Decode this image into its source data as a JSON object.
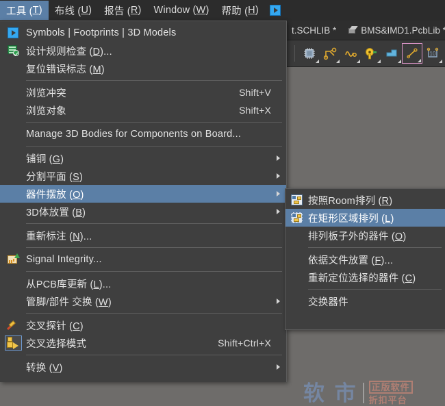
{
  "menubar": {
    "items": [
      {
        "label": "工具 (T)",
        "text": "工具 (",
        "mnemonic": "T",
        "tail": ")",
        "active": true,
        "name": "menubar-item-tools"
      },
      {
        "label": "布线 (U)",
        "text": "布线 (",
        "mnemonic": "U",
        "tail": ")",
        "active": false,
        "name": "menubar-item-route"
      },
      {
        "label": "报告 (R)",
        "text": "报告 (",
        "mnemonic": "R",
        "tail": ")",
        "active": false,
        "name": "menubar-item-reports"
      },
      {
        "label": "Window (W)",
        "text": "Window (",
        "mnemonic": "W",
        "tail": ")",
        "active": false,
        "name": "menubar-item-window"
      },
      {
        "label": "帮助 (H)",
        "text": "帮助 (",
        "mnemonic": "H",
        "tail": ")",
        "active": false,
        "name": "menubar-item-help"
      }
    ],
    "overflow_icon": "play-box-icon"
  },
  "tabs": [
    {
      "label": "t.SCHLIB *",
      "icon": null
    },
    {
      "label": "BMS&IMD1.PcbLib *",
      "icon": "cube-icon"
    }
  ],
  "toolbar": {
    "buttons": [
      {
        "name": "place-component-icon",
        "label": "",
        "framed": false
      },
      {
        "name": "place-interactive-route-icon",
        "label": "",
        "framed": false
      },
      {
        "name": "place-differential-pair-icon",
        "label": "",
        "framed": false
      },
      {
        "name": "place-pad-icon",
        "label": "",
        "framed": false
      },
      {
        "name": "place-polygon-icon",
        "label": "",
        "framed": false
      },
      {
        "name": "place-line-icon",
        "label": "",
        "framed": true
      },
      {
        "name": "place-dimension-icon",
        "label": "10",
        "framed": false
      }
    ]
  },
  "tools_menu": {
    "title": "工具",
    "items": [
      {
        "type": "item",
        "icon": "play-box-icon",
        "label": "Symbols | Footprints | 3D Models",
        "mnemonic": "",
        "shortcut": "",
        "submenu": false,
        "highlight": false,
        "name": "menu-item-symbols-footprints-3d-models"
      },
      {
        "type": "item",
        "icon": "drc-icon",
        "label": "设计规则检查 (",
        "mnemonic": "D",
        "tail": ")...",
        "shortcut": "",
        "submenu": false,
        "highlight": false,
        "name": "menu-item-design-rule-check"
      },
      {
        "type": "item",
        "icon": "",
        "label": "复位错误标志 (",
        "mnemonic": "M",
        "tail": ")",
        "shortcut": "",
        "submenu": false,
        "highlight": false,
        "name": "menu-item-reset-error-markers"
      },
      {
        "type": "sep"
      },
      {
        "type": "item",
        "icon": "",
        "label": "浏览冲突",
        "mnemonic": "",
        "tail": "",
        "shortcut": "Shift+V",
        "submenu": false,
        "highlight": false,
        "name": "menu-item-browse-violations"
      },
      {
        "type": "item",
        "icon": "",
        "label": "浏览对象",
        "mnemonic": "",
        "tail": "",
        "shortcut": "Shift+X",
        "submenu": false,
        "highlight": false,
        "name": "menu-item-browse-objects"
      },
      {
        "type": "sep"
      },
      {
        "type": "item",
        "icon": "",
        "label": "Manage 3D Bodies for Components on Board...",
        "mnemonic": "",
        "tail": "",
        "shortcut": "",
        "submenu": false,
        "highlight": false,
        "name": "menu-item-manage-3d-bodies"
      },
      {
        "type": "sep"
      },
      {
        "type": "item",
        "icon": "",
        "label": "铺铜 (",
        "mnemonic": "G",
        "tail": ")",
        "shortcut": "",
        "submenu": true,
        "highlight": false,
        "name": "menu-item-polygon-pours"
      },
      {
        "type": "item",
        "icon": "",
        "label": "分割平面 (",
        "mnemonic": "S",
        "tail": ")",
        "shortcut": "",
        "submenu": true,
        "highlight": false,
        "name": "menu-item-split-planes"
      },
      {
        "type": "item",
        "icon": "",
        "label": "器件摆放 (",
        "mnemonic": "O",
        "tail": ")",
        "shortcut": "",
        "submenu": true,
        "highlight": true,
        "name": "menu-item-component-placement"
      },
      {
        "type": "item",
        "icon": "",
        "label": "3D体放置 (",
        "mnemonic": "B",
        "tail": ")",
        "shortcut": "",
        "submenu": true,
        "highlight": false,
        "name": "menu-item-3d-body-placement"
      },
      {
        "type": "sep"
      },
      {
        "type": "item",
        "icon": "",
        "label": "重新标注 (",
        "mnemonic": "N",
        "tail": ")...",
        "shortcut": "",
        "submenu": false,
        "highlight": false,
        "name": "menu-item-re-annotate"
      },
      {
        "type": "sep"
      },
      {
        "type": "item",
        "icon": "signal-integrity-icon",
        "label": "Signal Integrity...",
        "mnemonic": "",
        "tail": "",
        "shortcut": "",
        "submenu": false,
        "highlight": false,
        "name": "menu-item-signal-integrity"
      },
      {
        "type": "sep"
      },
      {
        "type": "item",
        "icon": "",
        "label": "从PCB库更新 (",
        "mnemonic": "L",
        "tail": ")...",
        "shortcut": "",
        "submenu": false,
        "highlight": false,
        "name": "menu-item-update-from-pcb-library"
      },
      {
        "type": "item",
        "icon": "",
        "label": "管脚/部件 交换 (",
        "mnemonic": "W",
        "tail": ")",
        "shortcut": "",
        "submenu": true,
        "highlight": false,
        "name": "menu-item-pin-part-swapping"
      },
      {
        "type": "sep"
      },
      {
        "type": "item",
        "icon": "cross-probe-icon",
        "label": "交叉探针 (",
        "mnemonic": "C",
        "tail": ")",
        "shortcut": "",
        "submenu": false,
        "highlight": false,
        "name": "menu-item-cross-probe"
      },
      {
        "type": "item",
        "icon": "cross-select-icon",
        "label": "交叉选择模式",
        "mnemonic": "",
        "tail": "",
        "shortcut": "Shift+Ctrl+X",
        "submenu": false,
        "highlight": false,
        "name": "menu-item-cross-select-mode"
      },
      {
        "type": "sep"
      },
      {
        "type": "item",
        "icon": "",
        "label": "转换 (",
        "mnemonic": "V",
        "tail": ")",
        "shortcut": "",
        "submenu": true,
        "highlight": false,
        "name": "menu-item-convert"
      }
    ]
  },
  "submenu": {
    "parent": "器件摆放 (O)",
    "items": [
      {
        "type": "item",
        "icon": "arrange-room-icon",
        "label": "按照Room排列 (",
        "mnemonic": "R",
        "tail": ")",
        "highlight": false,
        "name": "submenu-item-arrange-within-room"
      },
      {
        "type": "item",
        "icon": "arrange-rect-icon",
        "label": "在矩形区域排列 (",
        "mnemonic": "L",
        "tail": ")",
        "highlight": true,
        "name": "submenu-item-arrange-within-rectangle"
      },
      {
        "type": "item",
        "icon": "",
        "label": "排列板子外的器件 (",
        "mnemonic": "O",
        "tail": ")",
        "highlight": false,
        "name": "submenu-item-arrange-outside-board"
      },
      {
        "type": "sep"
      },
      {
        "type": "item",
        "icon": "",
        "label": "依据文件放置 (",
        "mnemonic": "F",
        "tail": ")...",
        "highlight": false,
        "name": "submenu-item-place-from-file"
      },
      {
        "type": "item",
        "icon": "",
        "label": "重新定位选择的器件 (",
        "mnemonic": "C",
        "tail": ")",
        "highlight": false,
        "name": "submenu-item-reposition-selected-components"
      },
      {
        "type": "sep"
      },
      {
        "type": "item",
        "icon": "",
        "label": "交换器件",
        "mnemonic": "",
        "tail": "",
        "highlight": false,
        "name": "submenu-item-swap-components"
      }
    ]
  },
  "watermark": {
    "main": "软 市",
    "line1": "正版软件",
    "line2": "折扣平台"
  },
  "colors": {
    "menu_bg": "#3f3f3f",
    "menubar_bg": "#2c2c2c",
    "highlight": "#5b7fa6",
    "canvas": "#6e6c6a",
    "toolbar_bg": "#3a3a3a",
    "text": "#e2e2e2"
  }
}
